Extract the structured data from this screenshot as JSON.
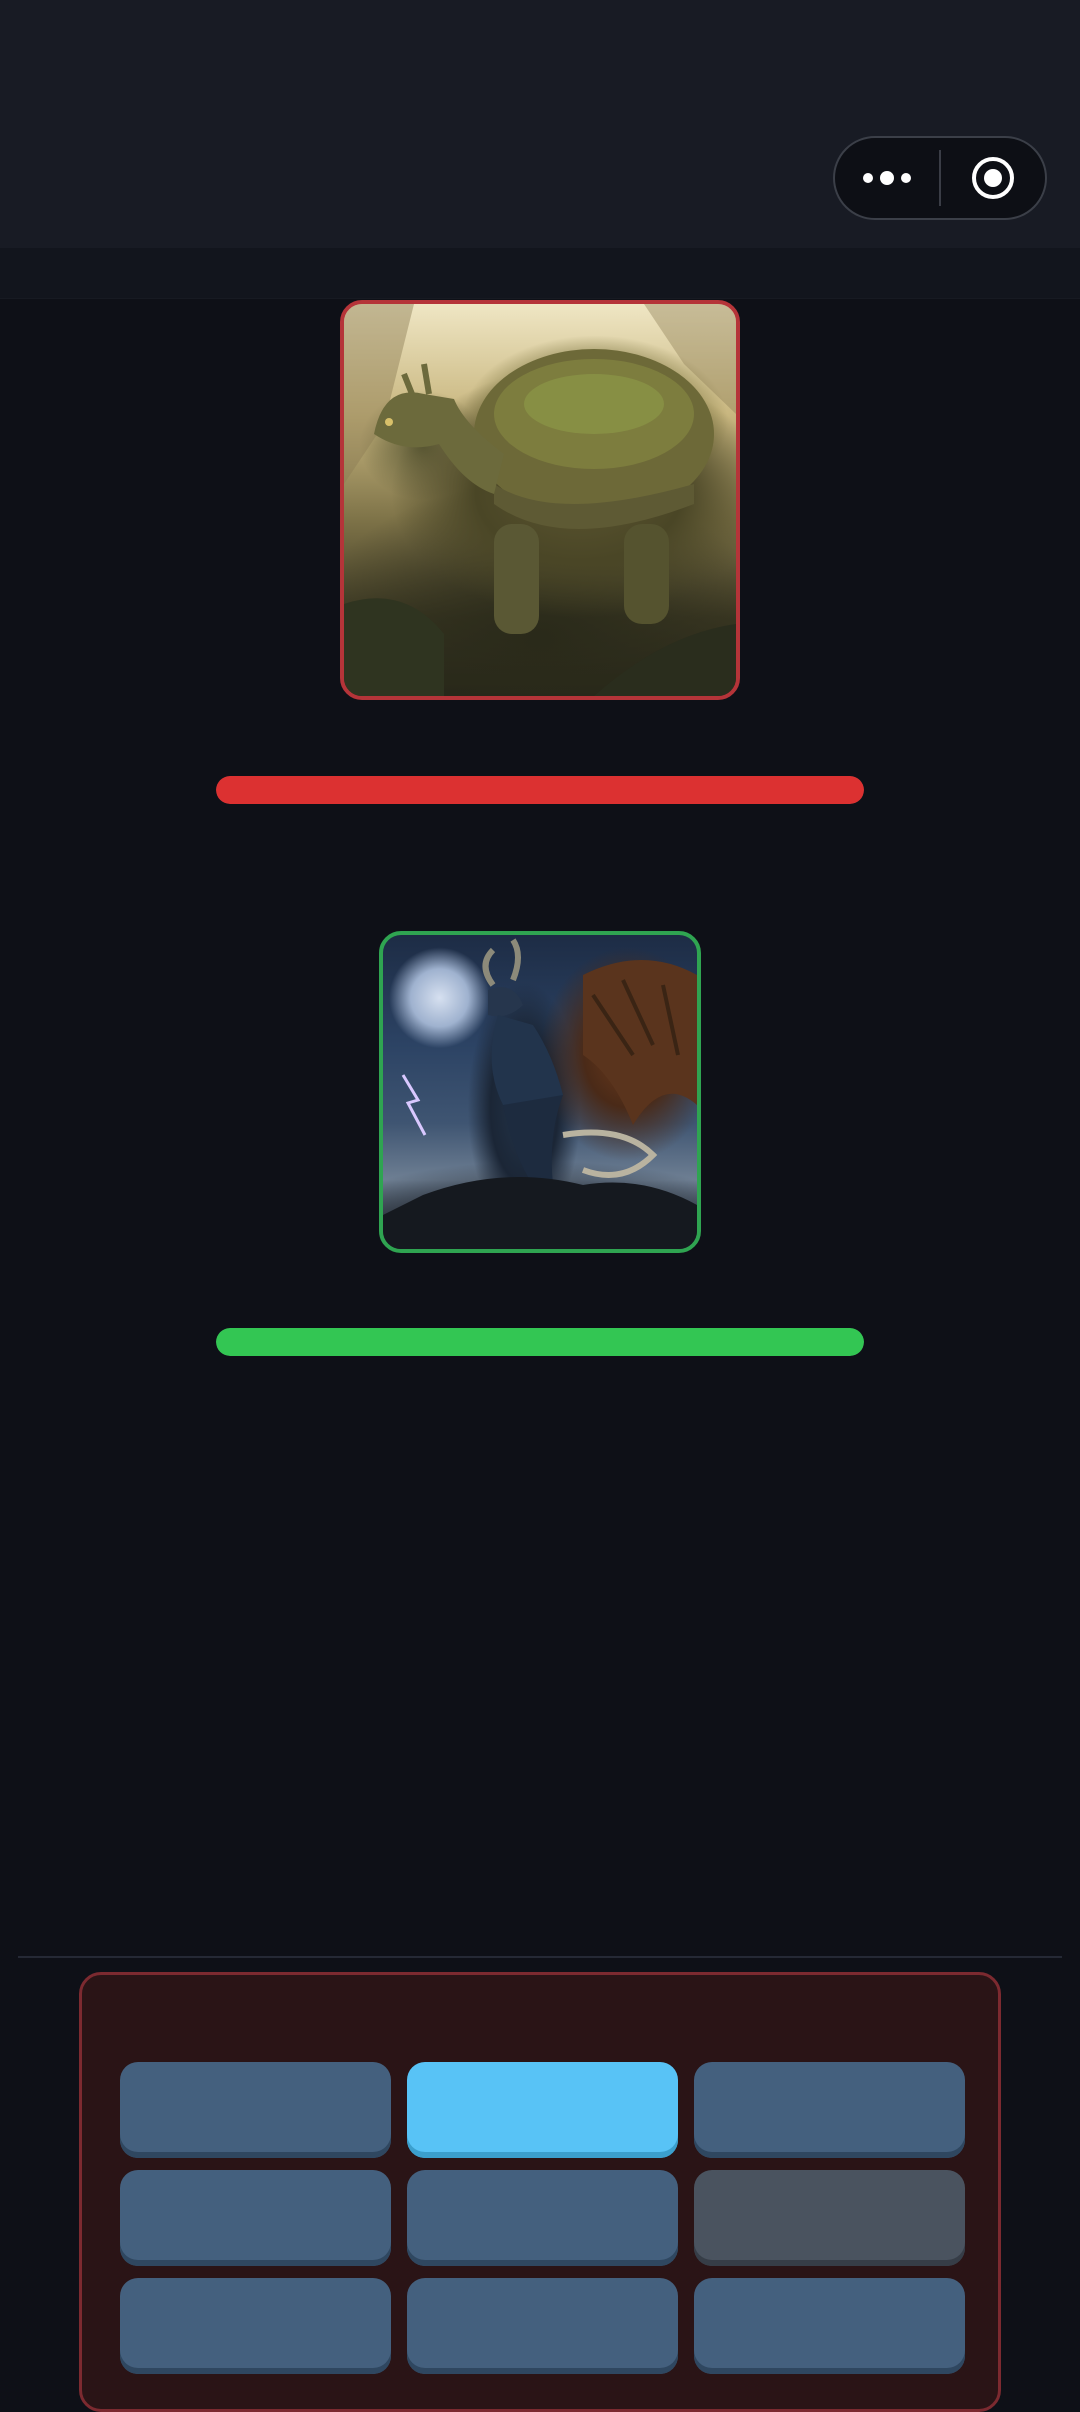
{
  "header": {
    "more_icon": "more-dots-icon",
    "target_icon": "record-target-icon"
  },
  "battle": {
    "enemy": {
      "name": "",
      "image_icon": "ancient-turtle-portrait",
      "hp_fraction": 1.0,
      "accent": "#b53439",
      "hp_color": "#dc3131"
    },
    "player": {
      "name": "",
      "image_icon": "storm-dragon-portrait",
      "hp_fraction": 1.0,
      "accent": "#2fa451",
      "hp_color": "#33c653"
    }
  },
  "action_grid": {
    "tiles": [
      {
        "state": "normal"
      },
      {
        "state": "active"
      },
      {
        "state": "normal"
      },
      {
        "state": "normal"
      },
      {
        "state": "normal"
      },
      {
        "state": "disabled"
      },
      {
        "state": "normal"
      },
      {
        "state": "normal"
      },
      {
        "state": "normal"
      }
    ],
    "colors": {
      "normal": "#44607e",
      "active": "#58c3f6",
      "disabled": "#4a535f",
      "panel_border": "#7c2a30"
    }
  }
}
